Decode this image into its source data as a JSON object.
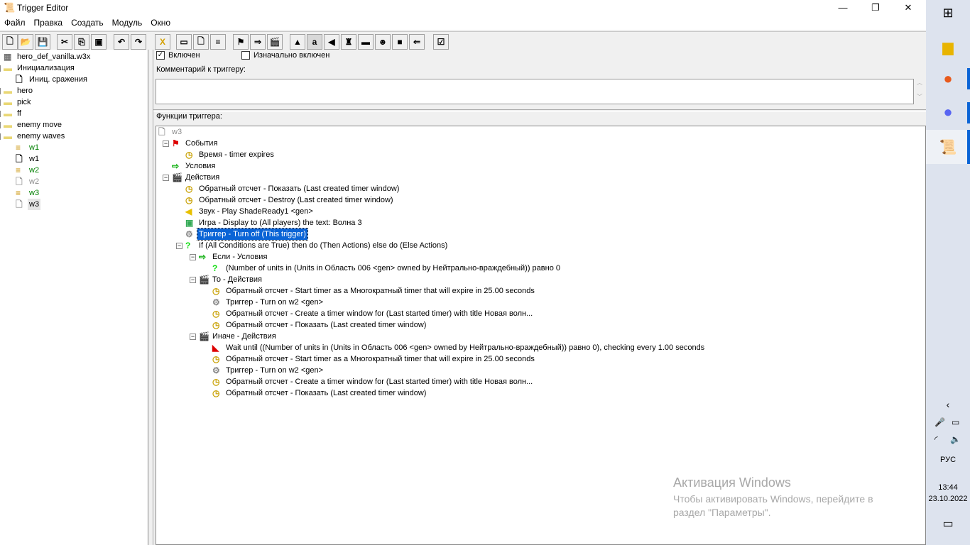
{
  "window": {
    "title": "Trigger Editor",
    "minimize": "—",
    "maximize": "❐",
    "close": "✕"
  },
  "menu": [
    "Файл",
    "Правка",
    "Создать",
    "Модуль",
    "Окно"
  ],
  "toolbar": [
    {
      "icon": "new-icon",
      "g": "🗋"
    },
    {
      "icon": "open-icon",
      "g": "📂"
    },
    {
      "icon": "save-icon",
      "g": "💾"
    },
    {
      "icon": "cut-icon",
      "g": "✂"
    },
    {
      "icon": "copy-icon",
      "g": "⎘"
    },
    {
      "icon": "paste-icon",
      "g": "▣"
    },
    {
      "icon": "undo-icon",
      "g": "↶"
    },
    {
      "icon": "redo-icon",
      "g": "↷"
    },
    {
      "icon": "delete-icon",
      "g": "X"
    },
    {
      "icon": "new-category-icon",
      "g": "▭"
    },
    {
      "icon": "new-trigger-icon",
      "g": "🗋"
    },
    {
      "icon": "new-comment-icon",
      "g": "≡"
    },
    {
      "icon": "new-event-icon",
      "g": "⚑"
    },
    {
      "icon": "new-condition-icon",
      "g": "⇒"
    },
    {
      "icon": "new-action-icon",
      "g": "🎬"
    },
    {
      "icon": "terrain-editor-icon",
      "g": "▲"
    },
    {
      "icon": "unit-editor-icon",
      "g": "a"
    },
    {
      "icon": "sound-editor-icon",
      "g": "◀"
    },
    {
      "icon": "object-editor-icon",
      "g": "♜"
    },
    {
      "icon": "campaign-editor-icon",
      "g": "▬"
    },
    {
      "icon": "ai-editor-icon",
      "g": "☻"
    },
    {
      "icon": "import-manager-icon",
      "g": "■"
    },
    {
      "icon": "test-map-icon",
      "g": "⇐"
    },
    {
      "icon": "test-icon",
      "g": "☑"
    }
  ],
  "left_tree": [
    {
      "level": 0,
      "icon": "map",
      "text": "hero_def_vanilla.w3x"
    },
    {
      "level": 0,
      "exp": "-",
      "icon": "folder-open",
      "text": "Инициализация"
    },
    {
      "level": 1,
      "icon": "trigger",
      "text": "Иниц. сражения"
    },
    {
      "level": 0,
      "exp": "+",
      "icon": "folder",
      "text": "hero"
    },
    {
      "level": 0,
      "exp": "+",
      "icon": "folder",
      "text": "pick"
    },
    {
      "level": 0,
      "exp": "+",
      "icon": "folder",
      "text": "ff"
    },
    {
      "level": 0,
      "exp": "+",
      "icon": "folder",
      "text": "enemy move"
    },
    {
      "level": 0,
      "exp": "-",
      "icon": "folder-open",
      "text": "enemy waves"
    },
    {
      "level": 1,
      "icon": "comment",
      "text": "w1",
      "color": "#008000"
    },
    {
      "level": 1,
      "icon": "trigger",
      "text": "w1"
    },
    {
      "level": 1,
      "icon": "comment",
      "text": "w2",
      "color": "#008000"
    },
    {
      "level": 1,
      "icon": "trigger-disabled",
      "text": "w2",
      "color": "#8c8c8c"
    },
    {
      "level": 1,
      "icon": "comment",
      "text": "w3",
      "color": "#008000"
    },
    {
      "level": 1,
      "icon": "trigger-disabled",
      "text": "w3",
      "selected": true
    }
  ],
  "options": {
    "enabled_label": "Включен",
    "enabled": true,
    "initially_on_label": "Изначально включен",
    "initially_on": false
  },
  "comment_label": "Комментарий к триггеру:",
  "comment_value": "",
  "functions_label": "Функции триггера:",
  "func_tree": [
    {
      "level": 0,
      "icon": "trigger-disabled",
      "text": "w3",
      "color": "#8c8c8c"
    },
    {
      "level": 1,
      "exp": "-",
      "icon": "event",
      "text": "События"
    },
    {
      "level": 2,
      "icon": "clock",
      "text": "Время - timer expires"
    },
    {
      "level": 1,
      "icon": "condition",
      "text": "Условия"
    },
    {
      "level": 1,
      "exp": "-",
      "icon": "action",
      "text": "Действия"
    },
    {
      "level": 2,
      "icon": "clock",
      "text": "Обратный отсчет - Показать (Last created timer window)"
    },
    {
      "level": 2,
      "icon": "clock",
      "text": "Обратный отсчет - Destroy (Last created timer window)"
    },
    {
      "level": 2,
      "icon": "sound",
      "text": "Звук - Play ShadeReady1 <gen>"
    },
    {
      "level": 2,
      "icon": "game",
      "text": "Игра - Display to (All players) the text: Волна 3"
    },
    {
      "level": 2,
      "icon": "gear",
      "text": "Триггер - Turn off (This trigger)",
      "selected": true
    },
    {
      "level": 2,
      "exp": "-",
      "icon": "question",
      "text": "If (All Conditions are True) then do (Then Actions) else do (Else Actions)"
    },
    {
      "level": 3,
      "exp": "-",
      "icon": "condition",
      "text": "Если - Условия"
    },
    {
      "level": 4,
      "icon": "question",
      "text": "(Number of units in (Units in Область 006 <gen> owned by Нейтрально-враждебный)) равно 0"
    },
    {
      "level": 3,
      "exp": "-",
      "icon": "action",
      "text": "То - Действия"
    },
    {
      "level": 4,
      "icon": "clock",
      "text": "Обратный отсчет - Start timer as a Многократный timer that will expire in 25.00 seconds"
    },
    {
      "level": 4,
      "icon": "gear",
      "text": "Триггер - Turn on w2 <gen>"
    },
    {
      "level": 4,
      "icon": "clock",
      "text": "Обратный отсчет - Create a timer window for (Last started timer) with title Новая волн..."
    },
    {
      "level": 4,
      "icon": "clock",
      "text": "Обратный отсчет - Показать (Last created timer window)"
    },
    {
      "level": 3,
      "exp": "-",
      "icon": "action",
      "text": "Иначе - Действия"
    },
    {
      "level": 4,
      "icon": "wait",
      "text": "Wait until ((Number of units in (Units in Область 006 <gen> owned by Нейтрально-враждебный)) равно 0), checking every 1.00 seconds"
    },
    {
      "level": 4,
      "icon": "clock",
      "text": "Обратный отсчет - Start timer as a Многократный timer that will expire in 25.00 seconds"
    },
    {
      "level": 4,
      "icon": "gear",
      "text": "Триггер - Turn on w2 <gen>"
    },
    {
      "level": 4,
      "icon": "clock",
      "text": "Обратный отсчет - Create a timer window for (Last started timer) with title Новая волн..."
    },
    {
      "level": 4,
      "icon": "clock",
      "text": "Обратный отсчет - Показать (Last created timer window)"
    }
  ],
  "watermark": {
    "title": "Активация Windows",
    "line1": "Чтобы активировать Windows, перейдите в",
    "line2": "раздел \"Параметры\"."
  },
  "taskbar": {
    "lang": "РУС",
    "time": "13:44",
    "date": "23.10.2022"
  }
}
